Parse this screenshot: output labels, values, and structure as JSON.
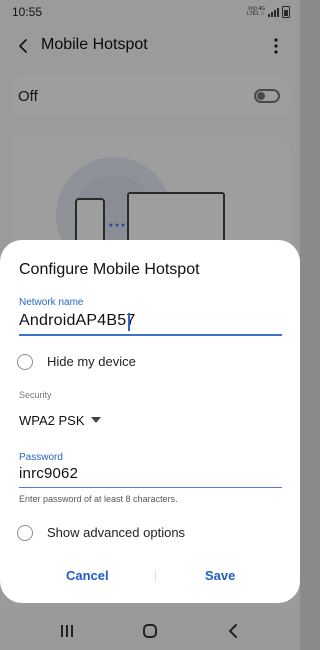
{
  "status_bar": {
    "time": "10:55",
    "network_line1": "Vo)) 4G",
    "network_line2": "LTE1 ↓↑"
  },
  "app_bar": {
    "title": "Mobile Hotspot",
    "back_icon": "back-arrow-icon",
    "more_icon": "more-vert-icon"
  },
  "hotspot_toggle": {
    "label": "Off",
    "state": "off"
  },
  "dialog": {
    "title": "Configure Mobile Hotspot",
    "network_name": {
      "label": "Network name",
      "value": "AndroidAP4B57"
    },
    "hide_device": {
      "label": "Hide my device",
      "checked": false
    },
    "security": {
      "label": "Security",
      "value": "WPA2 PSK"
    },
    "password": {
      "label": "Password",
      "value": "inrc9062",
      "helper": "Enter password of at least 8 characters."
    },
    "advanced": {
      "label": "Show advanced options",
      "checked": false
    },
    "cancel_label": "Cancel",
    "save_label": "Save"
  },
  "colors": {
    "accent": "#2a64c5",
    "button_text": "#1f5fc1"
  },
  "nav_bar": {
    "recents_icon": "recents-icon",
    "home_icon": "home-icon",
    "back_icon": "back-icon"
  }
}
